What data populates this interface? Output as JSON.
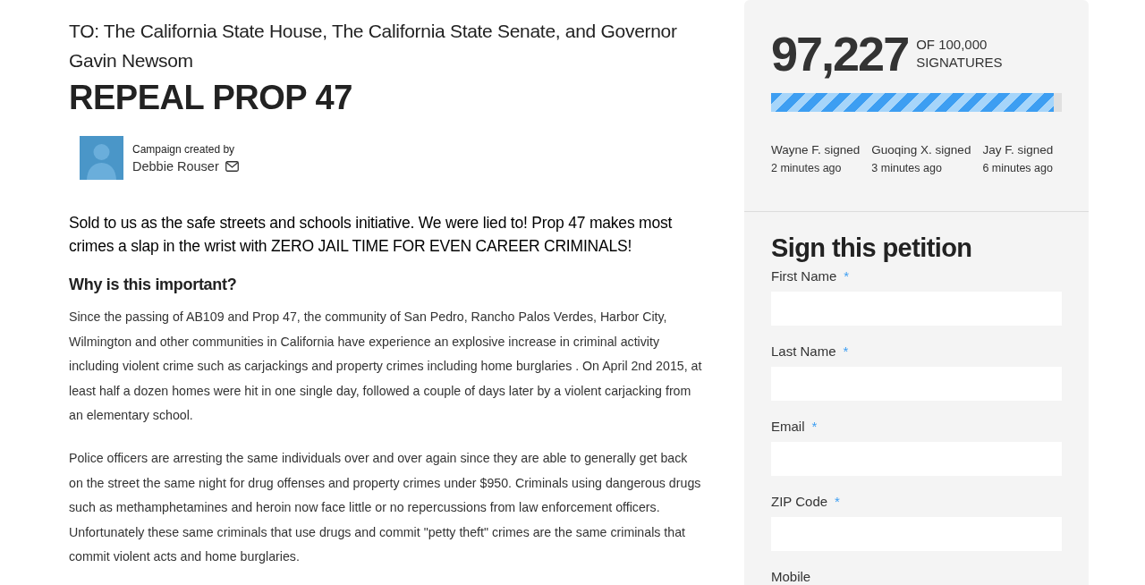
{
  "petition": {
    "recipients": "TO: The California State House, The California State Senate, and Governor Gavin Newsom",
    "title": "REPEAL PROP 47",
    "creator_label": "Campaign created by",
    "creator_name": "Debbie Rouser",
    "summary": "Sold to us as the safe streets and schools initiative. We were lied to! Prop 47 makes most crimes a slap in the wrist with ZERO JAIL TIME FOR EVEN CAREER CRIMINALS!",
    "why_heading": "Why is this important?",
    "paragraphs": [
      "Since the passing of AB109 and Prop 47, the community of San Pedro, Rancho Palos Verdes, Harbor City, Wilmington and other communities in California have experience an explosive increase in criminal activity including violent crime such as carjackings and property crimes including home burglaries . On April 2nd 2015, at least half a dozen homes were hit in one single day, followed a couple of days later by a violent carjacking from an elementary school.",
      "Police officers are arresting the same individuals over and over again since they are able to generally get back on the street the same night for drug offenses and property crimes under $950. Criminals using dangerous drugs such as methamphetamines and heroin now face little or no repercussions from law enforcement officers. Unfortunately these same criminals that use drugs and commit \"petty theft\" crimes are the same criminals that commit violent acts and home burglaries."
    ]
  },
  "sidebar": {
    "count": "97,227",
    "goal": "OF 100,000",
    "goal_unit": "SIGNATURES",
    "progress": {
      "level": 0.972
    },
    "recent": [
      {
        "name": "Wayne F. signed",
        "time": "2 minutes ago"
      },
      {
        "name": "Guoqing X. signed",
        "time": "3 minutes ago"
      },
      {
        "name": "Jay F. signed",
        "time": "6 minutes ago"
      }
    ],
    "form_title": "Sign this petition",
    "fields": [
      {
        "label": "First Name",
        "required_mark": "*",
        "kind": "input"
      },
      {
        "label": "Last Name",
        "required_mark": "*",
        "kind": "input"
      },
      {
        "label": "Email",
        "required_mark": "*",
        "kind": "input"
      },
      {
        "label": "ZIP Code",
        "required_mark": "*",
        "kind": "input"
      },
      {
        "label": "Mobile",
        "kind": "label"
      }
    ]
  }
}
